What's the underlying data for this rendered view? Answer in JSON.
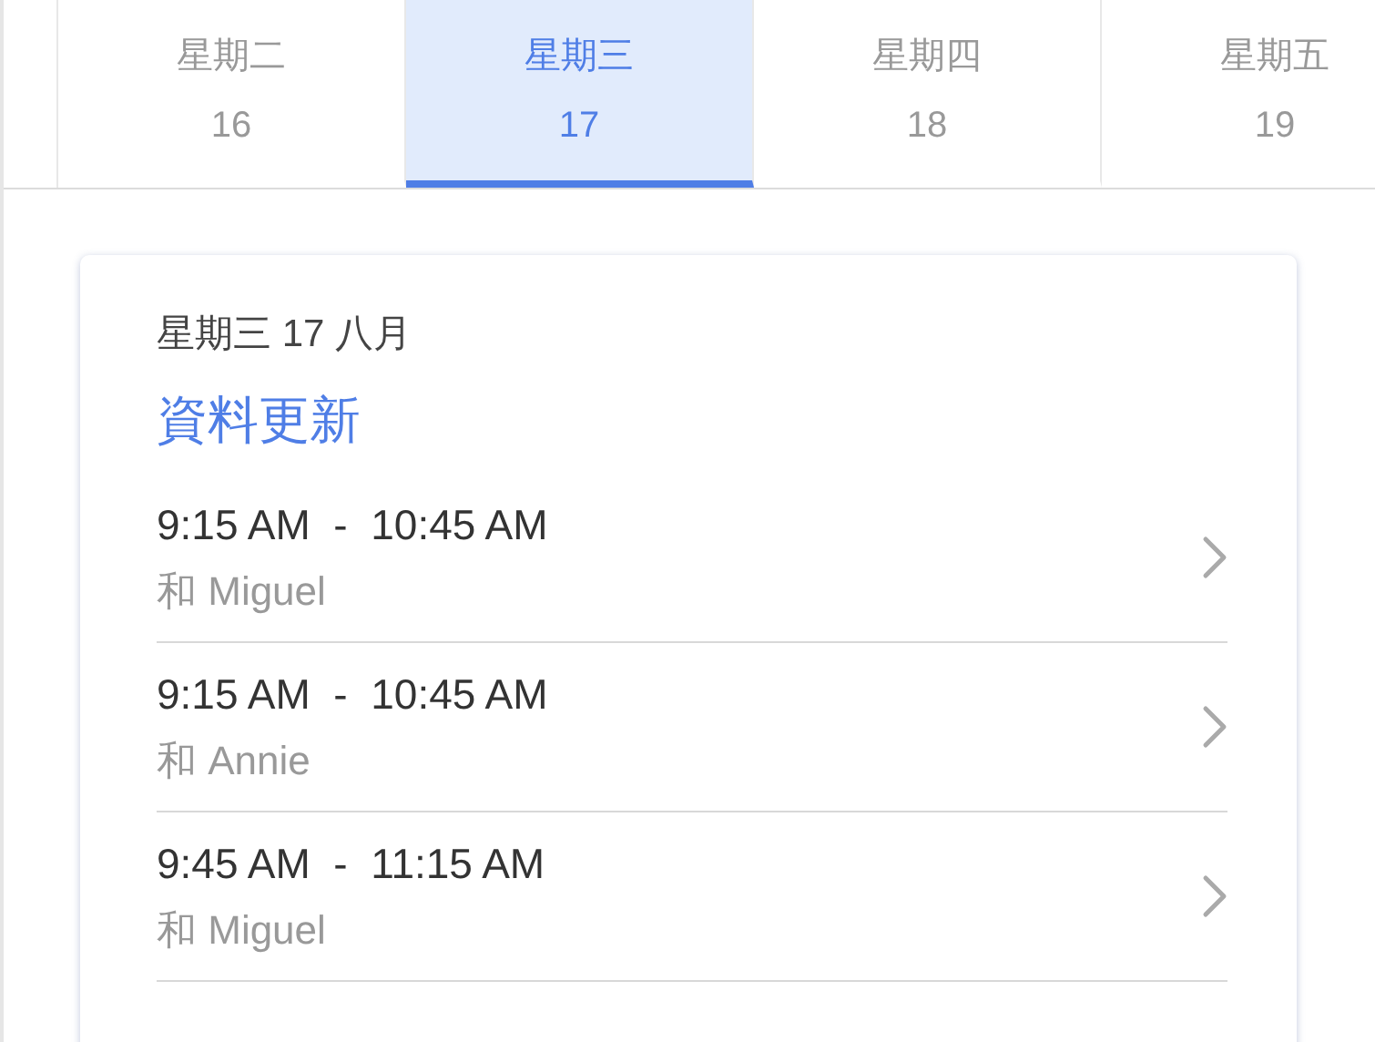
{
  "days": [
    {
      "weekday": "星期二",
      "date": "16",
      "selected": false
    },
    {
      "weekday": "星期三",
      "date": "17",
      "selected": true
    },
    {
      "weekday": "星期四",
      "date": "18",
      "selected": false
    },
    {
      "weekday": "星期五",
      "date": "19",
      "selected": false
    }
  ],
  "card": {
    "heading": "星期三 17 八月",
    "link": "資料更新",
    "appointments": [
      {
        "time": "9:15 AM  -  10:45 AM",
        "with": "和 Miguel"
      },
      {
        "time": "9:15 AM  -  10:45 AM",
        "with": "和 Annie"
      },
      {
        "time": "9:45 AM  -  11:15 AM",
        "with": "和 Miguel"
      }
    ]
  }
}
